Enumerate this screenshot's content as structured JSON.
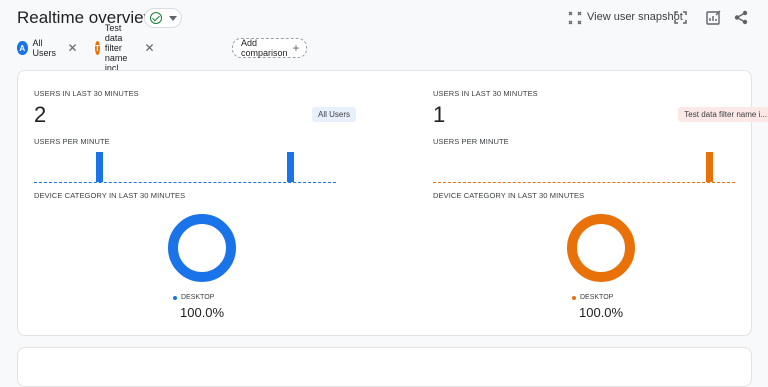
{
  "header": {
    "title": "Realtime overview",
    "snapshot_label": "View user snapshot"
  },
  "chips": {
    "items": [
      {
        "badge": "A",
        "label": "All Users",
        "color": "#1a73e8"
      },
      {
        "badge": "T",
        "label": "Test data filter name incl...",
        "color": "#e8710a"
      }
    ],
    "add_label": "Add comparison"
  },
  "panels": [
    {
      "users_label": "USERS IN LAST 30 MINUTES",
      "users_value": "2",
      "segment_label": "All Users",
      "per_minute_label": "USERS PER MINUTE",
      "device_label": "DEVICE CATEGORY IN LAST 30 MINUTES",
      "legend_label": "DESKTOP",
      "legend_value": "100.0%",
      "color": "#1a73e8",
      "segment_bg": "#e8f0fe",
      "segment_fg": "#3c4043"
    },
    {
      "users_label": "USERS IN LAST 30 MINUTES",
      "users_value": "1",
      "segment_label": "Test data filter name i...",
      "per_minute_label": "USERS PER MINUTE",
      "device_label": "DEVICE CATEGORY IN LAST 30 MINUTES",
      "legend_label": "DESKTOP",
      "legend_value": "100.0%",
      "color": "#e8710a",
      "segment_bg": "#fce8e6",
      "segment_fg": "#3c4043"
    }
  ],
  "chart_data": [
    {
      "type": "bar",
      "series": [
        {
          "name": "All Users",
          "values": [
            0,
            0,
            0,
            0,
            0,
            0,
            1,
            0,
            0,
            0,
            0,
            0,
            0,
            0,
            0,
            0,
            0,
            0,
            0,
            0,
            0,
            0,
            0,
            0,
            0,
            1,
            0,
            0,
            0,
            0
          ]
        }
      ]
    },
    {
      "type": "bar",
      "series": [
        {
          "name": "Test data filter name i...",
          "values": [
            0,
            0,
            0,
            0,
            0,
            0,
            0,
            0,
            0,
            0,
            0,
            0,
            0,
            0,
            0,
            0,
            0,
            0,
            0,
            0,
            0,
            0,
            0,
            0,
            0,
            0,
            0,
            1,
            0,
            0
          ]
        }
      ]
    },
    {
      "type": "pie",
      "categories": [
        "DESKTOP"
      ],
      "values": [
        100.0
      ]
    },
    {
      "type": "pie",
      "categories": [
        "DESKTOP"
      ],
      "values": [
        100.0
      ]
    }
  ]
}
